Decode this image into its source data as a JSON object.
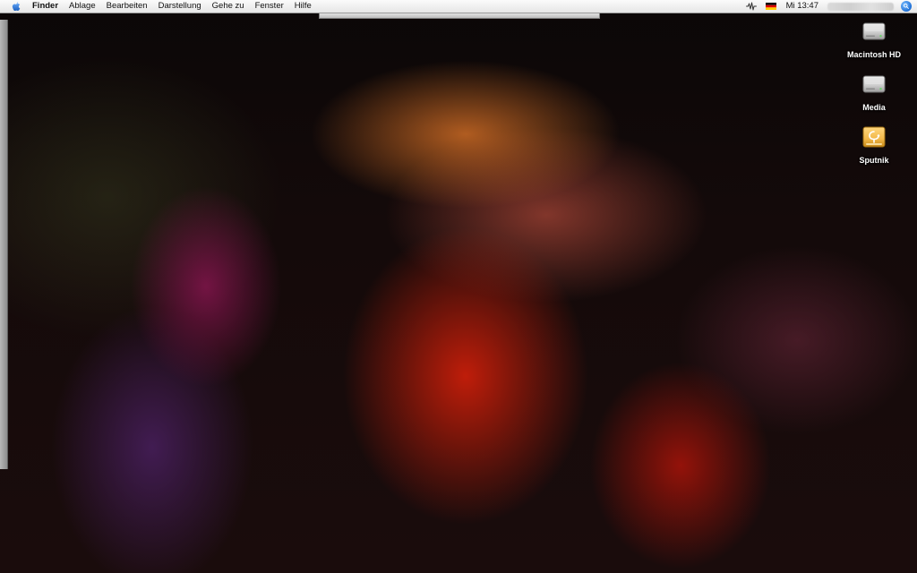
{
  "menubar": {
    "apple_menu_icon": "apple-icon",
    "app_name": "Finder",
    "items": [
      "Ablage",
      "Bearbeiten",
      "Darstellung",
      "Gehe zu",
      "Fenster",
      "Hilfe"
    ],
    "status_icons": [
      "audio-icon",
      "german-flag-icon"
    ],
    "clock": "Mi 13:47",
    "spotlight_icon": "spotlight-icon"
  },
  "desktop": {
    "icons": [
      {
        "label": "Macintosh HD",
        "icon": "hard-drive-icon"
      },
      {
        "label": "Media",
        "icon": "hard-drive-icon"
      },
      {
        "label": "Sputnik",
        "icon": "firewire-drive-icon"
      }
    ]
  },
  "colors": {
    "menubar_text": "#111111",
    "desktop_label": "#ffffff",
    "firewire_drive": "#f2b84a"
  }
}
